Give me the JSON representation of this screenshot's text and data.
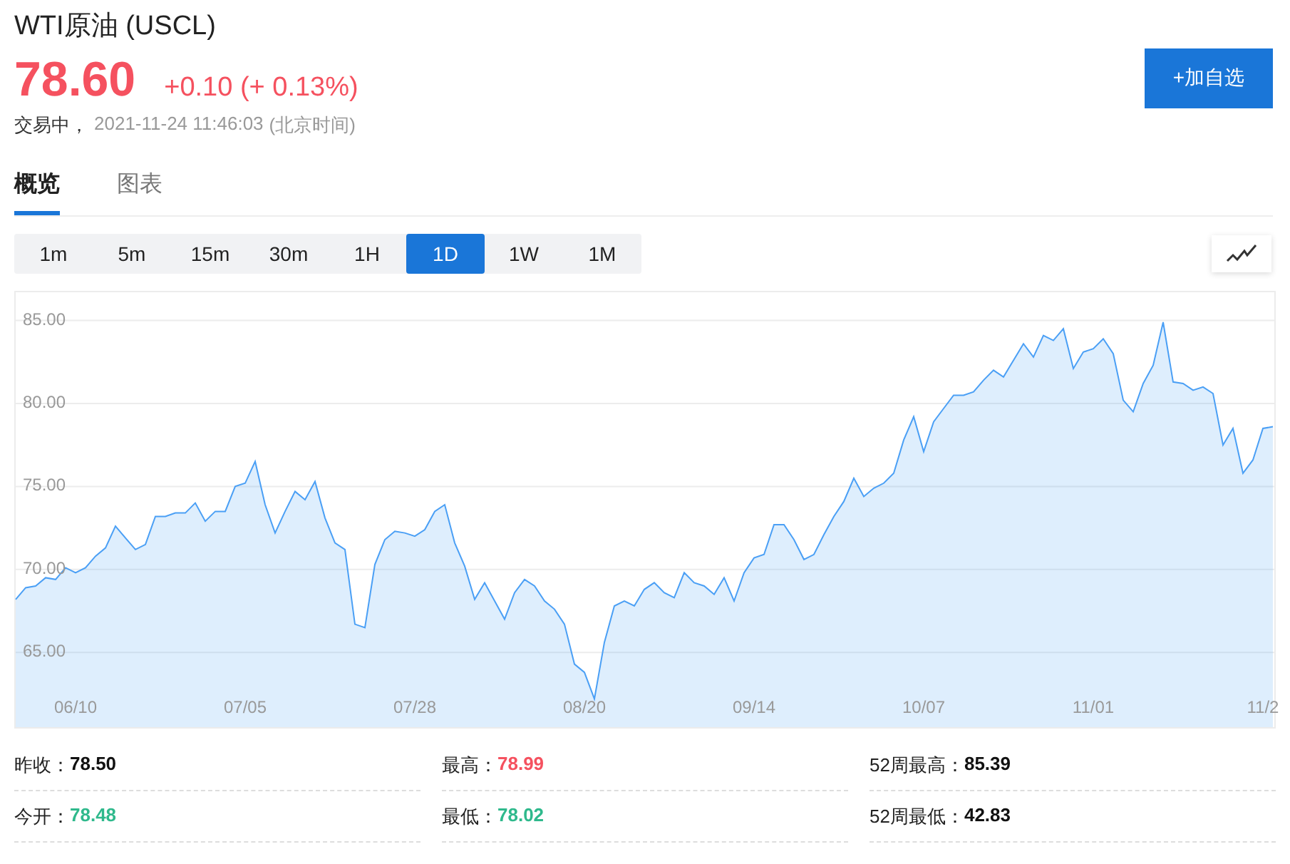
{
  "header": {
    "title": "WTI原油 (USCL)",
    "price": "78.60",
    "change": "+0.10 (+ 0.13%)",
    "status": "交易中，",
    "time": "2021-11-24 11:46:03",
    "timezone": "(北京时间)",
    "watch_button": "+加自选"
  },
  "tabs": [
    {
      "label": "概览",
      "selected": true
    },
    {
      "label": "图表",
      "selected": false
    }
  ],
  "intervals": [
    {
      "label": "1m",
      "selected": false
    },
    {
      "label": "5m",
      "selected": false
    },
    {
      "label": "15m",
      "selected": false
    },
    {
      "label": "30m",
      "selected": false
    },
    {
      "label": "1H",
      "selected": false
    },
    {
      "label": "1D",
      "selected": true
    },
    {
      "label": "1W",
      "selected": false
    },
    {
      "label": "1M",
      "selected": false
    }
  ],
  "chart_data": {
    "type": "area",
    "grid": true,
    "ylim": [
      60.5,
      86.7
    ],
    "categories": [
      null,
      null,
      null,
      null,
      null,
      null,
      "06/10",
      null,
      null,
      null,
      null,
      null,
      null,
      null,
      null,
      null,
      null,
      null,
      null,
      null,
      null,
      null,
      null,
      "07/05",
      null,
      null,
      null,
      null,
      null,
      null,
      null,
      null,
      null,
      null,
      null,
      null,
      null,
      null,
      null,
      null,
      "07/28",
      null,
      null,
      null,
      null,
      null,
      null,
      null,
      null,
      null,
      null,
      null,
      null,
      null,
      null,
      null,
      null,
      "08/20",
      null,
      null,
      null,
      null,
      null,
      null,
      null,
      null,
      null,
      null,
      null,
      null,
      null,
      null,
      null,
      null,
      "09/14",
      null,
      null,
      null,
      null,
      null,
      null,
      null,
      null,
      null,
      null,
      null,
      null,
      null,
      null,
      null,
      null,
      "10/07",
      null,
      null,
      null,
      null,
      null,
      null,
      null,
      null,
      null,
      null,
      null,
      null,
      null,
      null,
      null,
      null,
      "11/01",
      null,
      null,
      null,
      null,
      null,
      null,
      null,
      null,
      null,
      null,
      null,
      null,
      null,
      null,
      null,
      null,
      "11/2",
      null
    ],
    "yticks": [
      {
        "value": 65,
        "label": "65.00"
      },
      {
        "value": 70,
        "label": "70.00"
      },
      {
        "value": 75,
        "label": "75.00"
      },
      {
        "value": 80,
        "label": "80.00"
      },
      {
        "value": 85,
        "label": "85.00"
      }
    ],
    "series": [
      {
        "color": "#4a9ff5",
        "values": [
          68.2,
          68.9,
          69.0,
          69.5,
          69.4,
          70.1,
          69.8,
          70.1,
          70.8,
          71.3,
          72.6,
          71.9,
          71.2,
          71.5,
          73.2,
          73.2,
          73.4,
          73.4,
          74.0,
          72.9,
          73.5,
          73.5,
          75.0,
          75.2,
          76.5,
          73.9,
          72.2,
          73.5,
          74.7,
          74.2,
          75.3,
          73.1,
          71.6,
          71.2,
          66.7,
          66.5,
          70.3,
          71.8,
          72.3,
          72.2,
          72.0,
          72.4,
          73.5,
          73.9,
          71.6,
          70.2,
          68.2,
          69.2,
          68.1,
          67.0,
          68.6,
          69.4,
          69.0,
          68.1,
          67.6,
          66.7,
          64.3,
          63.8,
          62.2,
          65.6,
          67.8,
          68.1,
          67.8,
          68.8,
          69.2,
          68.6,
          68.3,
          69.8,
          69.2,
          69.0,
          68.5,
          69.5,
          68.1,
          69.8,
          70.7,
          70.9,
          72.7,
          72.7,
          71.8,
          70.6,
          70.9,
          72.1,
          73.2,
          74.1,
          75.5,
          74.4,
          74.9,
          75.2,
          75.8,
          77.8,
          79.2,
          77.1,
          78.9,
          79.7,
          80.5,
          80.5,
          80.7,
          81.4,
          82.0,
          81.6,
          82.6,
          83.6,
          82.8,
          84.1,
          83.8,
          84.5,
          82.1,
          83.1,
          83.3,
          83.9,
          83.0,
          80.2,
          79.5,
          81.2,
          82.3,
          84.9,
          81.3,
          81.2,
          80.8,
          81.0,
          80.6,
          77.5,
          78.5,
          75.8,
          76.6,
          78.5,
          78.6
        ]
      }
    ]
  },
  "stats": [
    {
      "label": "昨收：",
      "value": "78.50",
      "color": "#111111"
    },
    {
      "label": "最高：",
      "value": "78.99",
      "color": "#f5515f"
    },
    {
      "label": "52周最高：",
      "value": "85.39",
      "color": "#111111"
    },
    {
      "label": "今开：",
      "value": "78.48",
      "color": "#2fb98c"
    },
    {
      "label": "最低：",
      "value": "78.02",
      "color": "#2fb98c"
    },
    {
      "label": "52周最低：",
      "value": "42.83",
      "color": "#111111"
    }
  ]
}
